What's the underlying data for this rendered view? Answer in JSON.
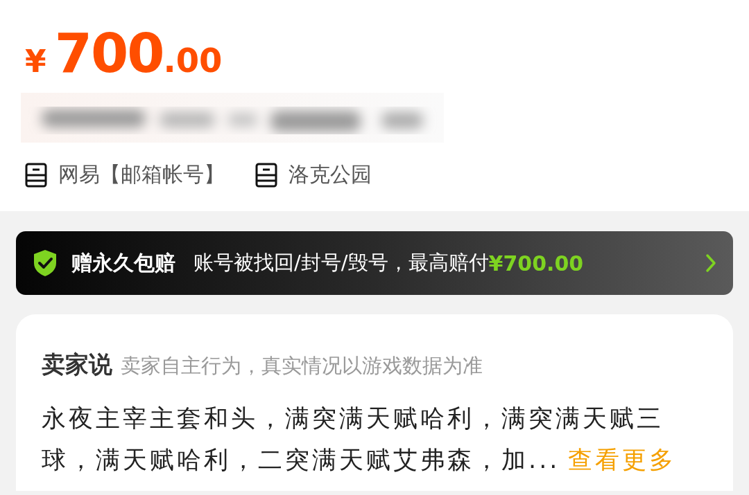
{
  "price": {
    "currency": "¥",
    "integer": "700",
    "decimal": ".00"
  },
  "tags": [
    {
      "label": "网易【邮箱帐号】"
    },
    {
      "label": "洛克公园"
    }
  ],
  "guarantee": {
    "title": "赠永久包赔",
    "description": "账号被找回/封号/毁号，最高赔付",
    "amount": "¥700.00"
  },
  "seller_note": {
    "title": "卖家说",
    "subtitle": "卖家自主行为，真实情况以游戏数据为准",
    "body": "永夜主宰主套和头，满突满天赋哈利，满突满天赋三球，满天赋哈利，二突满天赋艾弗森，加...",
    "more_link": "查看更多"
  }
}
